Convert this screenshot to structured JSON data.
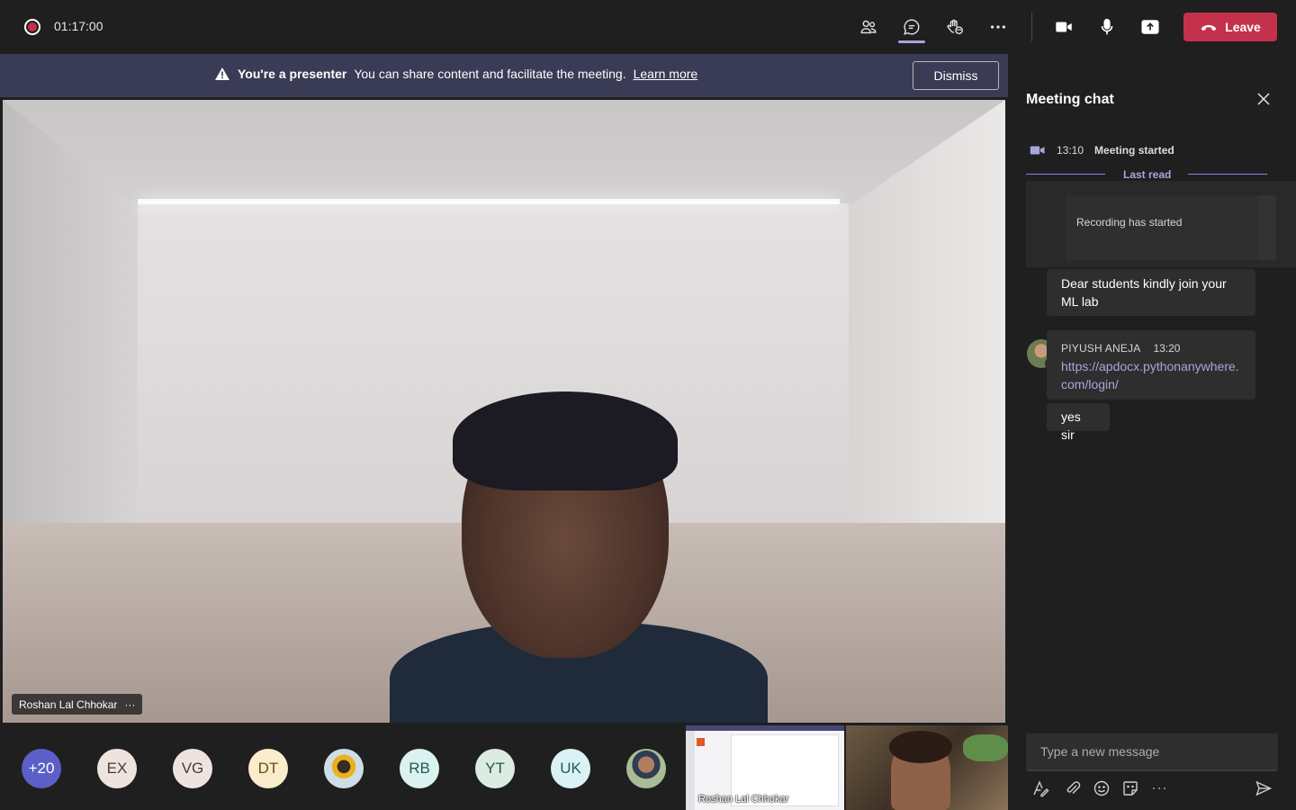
{
  "topbar": {
    "timer": "01:17:00",
    "leave_label": "Leave"
  },
  "banner": {
    "title": "You're a presenter",
    "message": "You can share content and facilitate the meeting.",
    "link": "Learn more",
    "dismiss_label": "Dismiss"
  },
  "main_video": {
    "participant_name": "Roshan Lal Chhokar",
    "more": "···"
  },
  "participants": [
    {
      "initials": "+20",
      "bg": "#5b5fc7",
      "fg": "#ffffff"
    },
    {
      "initials": "EX",
      "bg": "#efe3e0",
      "fg": "#4a3a36"
    },
    {
      "initials": "VG",
      "bg": "#efe3e0",
      "fg": "#4a3a36"
    },
    {
      "initials": "DT",
      "bg": "#fbeccc",
      "fg": "#6a4d12"
    },
    {
      "initials": "",
      "bg": "#d6e6ee",
      "fg": "#333333"
    },
    {
      "initials": "RB",
      "bg": "#dbf2f1",
      "fg": "#1f5a57"
    },
    {
      "initials": "YT",
      "bg": "#dbece2",
      "fg": "#235b39"
    },
    {
      "initials": "UK",
      "bg": "#dbf2f4",
      "fg": "#1e5a61"
    },
    {
      "initials": "",
      "bg": "#b9c7a8",
      "fg": "#333333"
    }
  ],
  "screen_share_thumb": {
    "label": "Roshan Lal Chhokar"
  },
  "chat": {
    "title": "Meeting chat",
    "event_time": "13:10",
    "event_text": "Meeting started",
    "last_read": "Last read",
    "recording_msg": "Recording has started",
    "messages": [
      {
        "text": "Dear students kindly join your ML lab"
      },
      {
        "author": "PIYUSH ANEJA",
        "time": "13:20",
        "text": "https://apdocx.pythonanywhere.com/login/"
      },
      {
        "text": "yes sir"
      }
    ],
    "compose_placeholder": "Type a new message"
  },
  "colors": {
    "leave": "#c4314b",
    "banner": "#3a3b55",
    "accent": "#a6a7dc"
  }
}
